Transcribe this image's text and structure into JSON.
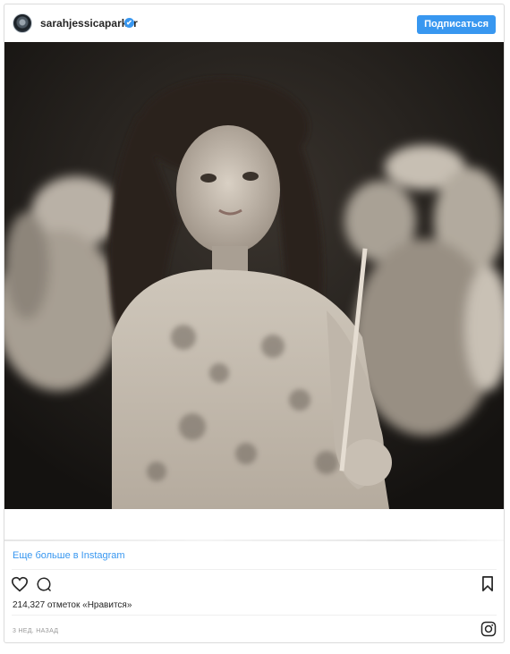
{
  "header": {
    "username": "sarahjessicaparker",
    "verified_mark": "✔",
    "follow_label": "Подписаться"
  },
  "post": {
    "image_alt": "Black and white childhood photo of a girl with long wavy hair holding a candle",
    "more_link": "Еще больше в Instagram",
    "likes_text": "214,327 отметок «Нравится»",
    "time_text": "3 НЕД. НАЗАД"
  },
  "icons": {
    "like": "heart-icon",
    "comment": "comment-icon",
    "save": "bookmark-icon",
    "instagram": "instagram-logo-icon"
  },
  "colors": {
    "accent": "#3897f0",
    "text": "#262626",
    "muted": "#999999",
    "border": "#dbdbdb"
  }
}
